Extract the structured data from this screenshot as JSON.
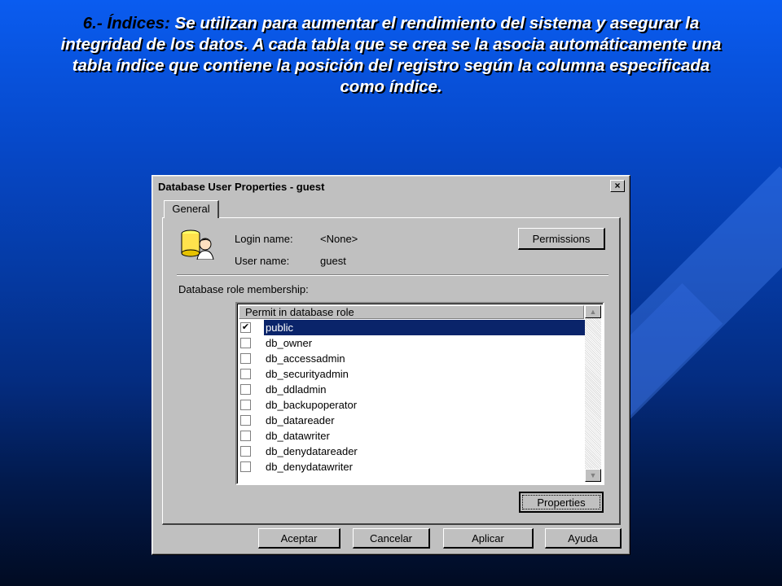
{
  "slide": {
    "number": "6.-",
    "keyword": "Índices:",
    "text": "Se utilizan para aumentar el rendimiento del sistema y asegurar la integridad de los datos. A cada tabla que se crea se la asocia automáticamente una tabla índice que contiene la posición del registro según la columna especificada como índice."
  },
  "dialog": {
    "title": "Database User Properties - guest",
    "close": "×",
    "tab": "General",
    "login_label": "Login name:",
    "login_value": "<None>",
    "user_label": "User name:",
    "user_value": "guest",
    "permissions_button": "Permissions",
    "membership_label": "Database role membership:",
    "list_header": "Permit in database role",
    "roles": [
      {
        "name": "public",
        "checked": true,
        "selected": true
      },
      {
        "name": "db_owner",
        "checked": false
      },
      {
        "name": "db_accessadmin",
        "checked": false
      },
      {
        "name": "db_securityadmin",
        "checked": false
      },
      {
        "name": "db_ddladmin",
        "checked": false
      },
      {
        "name": "db_backupoperator",
        "checked": false
      },
      {
        "name": "db_datareader",
        "checked": false
      },
      {
        "name": "db_datawriter",
        "checked": false
      },
      {
        "name": "db_denydatareader",
        "checked": false
      },
      {
        "name": "db_denydatawriter",
        "checked": false
      }
    ],
    "properties_button": "Properties",
    "buttons": {
      "ok": "Aceptar",
      "cancel": "Cancelar",
      "apply": "Aplicar",
      "help": "Ayuda"
    },
    "checkmark": "✔",
    "scroll_up": "▲",
    "scroll_down": "▼"
  }
}
